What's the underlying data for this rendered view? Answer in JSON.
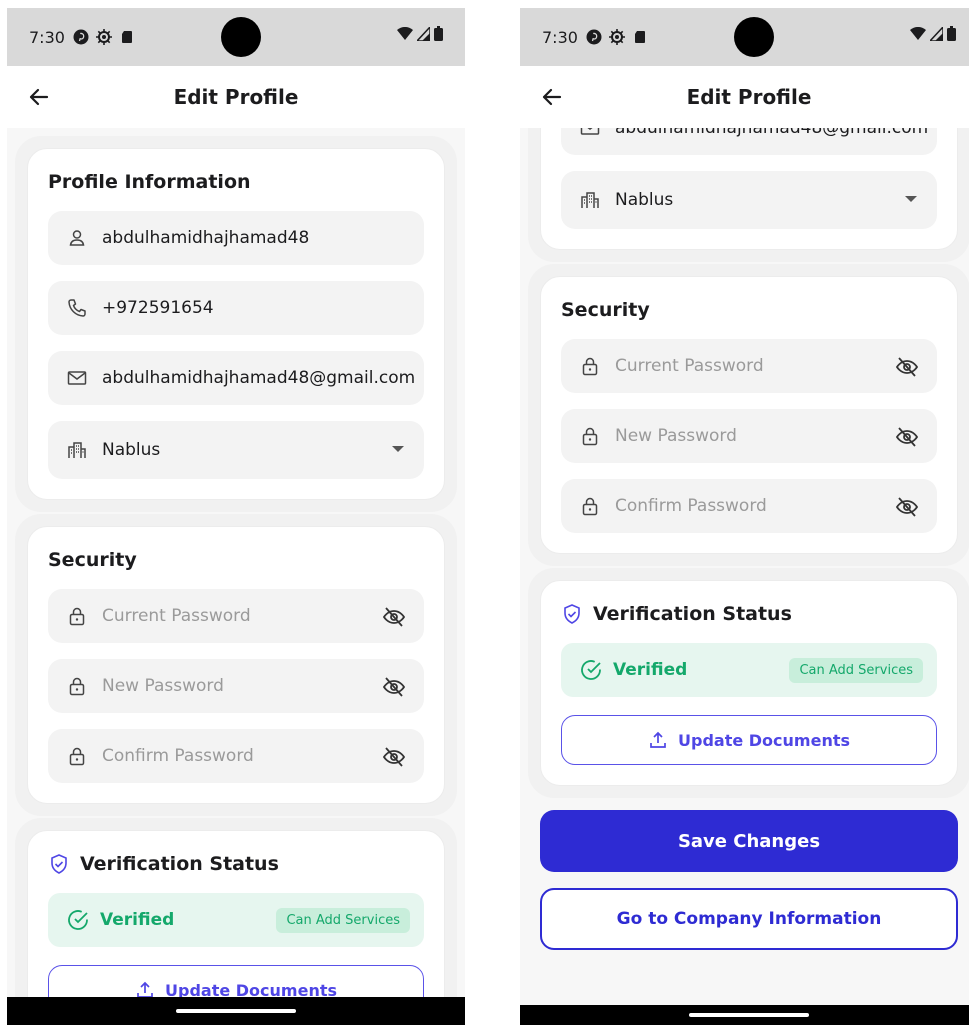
{
  "status_bar": {
    "time": "7:30"
  },
  "app_bar": {
    "title": "Edit Profile"
  },
  "profile": {
    "title": "Profile Information",
    "username": "abdulhamidhajhamad48",
    "phone": "+972591654",
    "email": "abdulhamidhajhamad48@gmail.com",
    "city": "Nablus"
  },
  "security": {
    "title": "Security",
    "current_placeholder": "Current Password",
    "new_placeholder": "New Password",
    "confirm_placeholder": "Confirm Password"
  },
  "verification": {
    "title": "Verification Status",
    "status": "Verified",
    "badge": "Can Add Services",
    "update_label": "Update Documents"
  },
  "actions": {
    "save_label": "Save Changes",
    "company_label": "Go to Company Information"
  },
  "colors": {
    "primary": "#2e2bd3",
    "success": "#14a86b",
    "accent": "#4f46e5"
  }
}
